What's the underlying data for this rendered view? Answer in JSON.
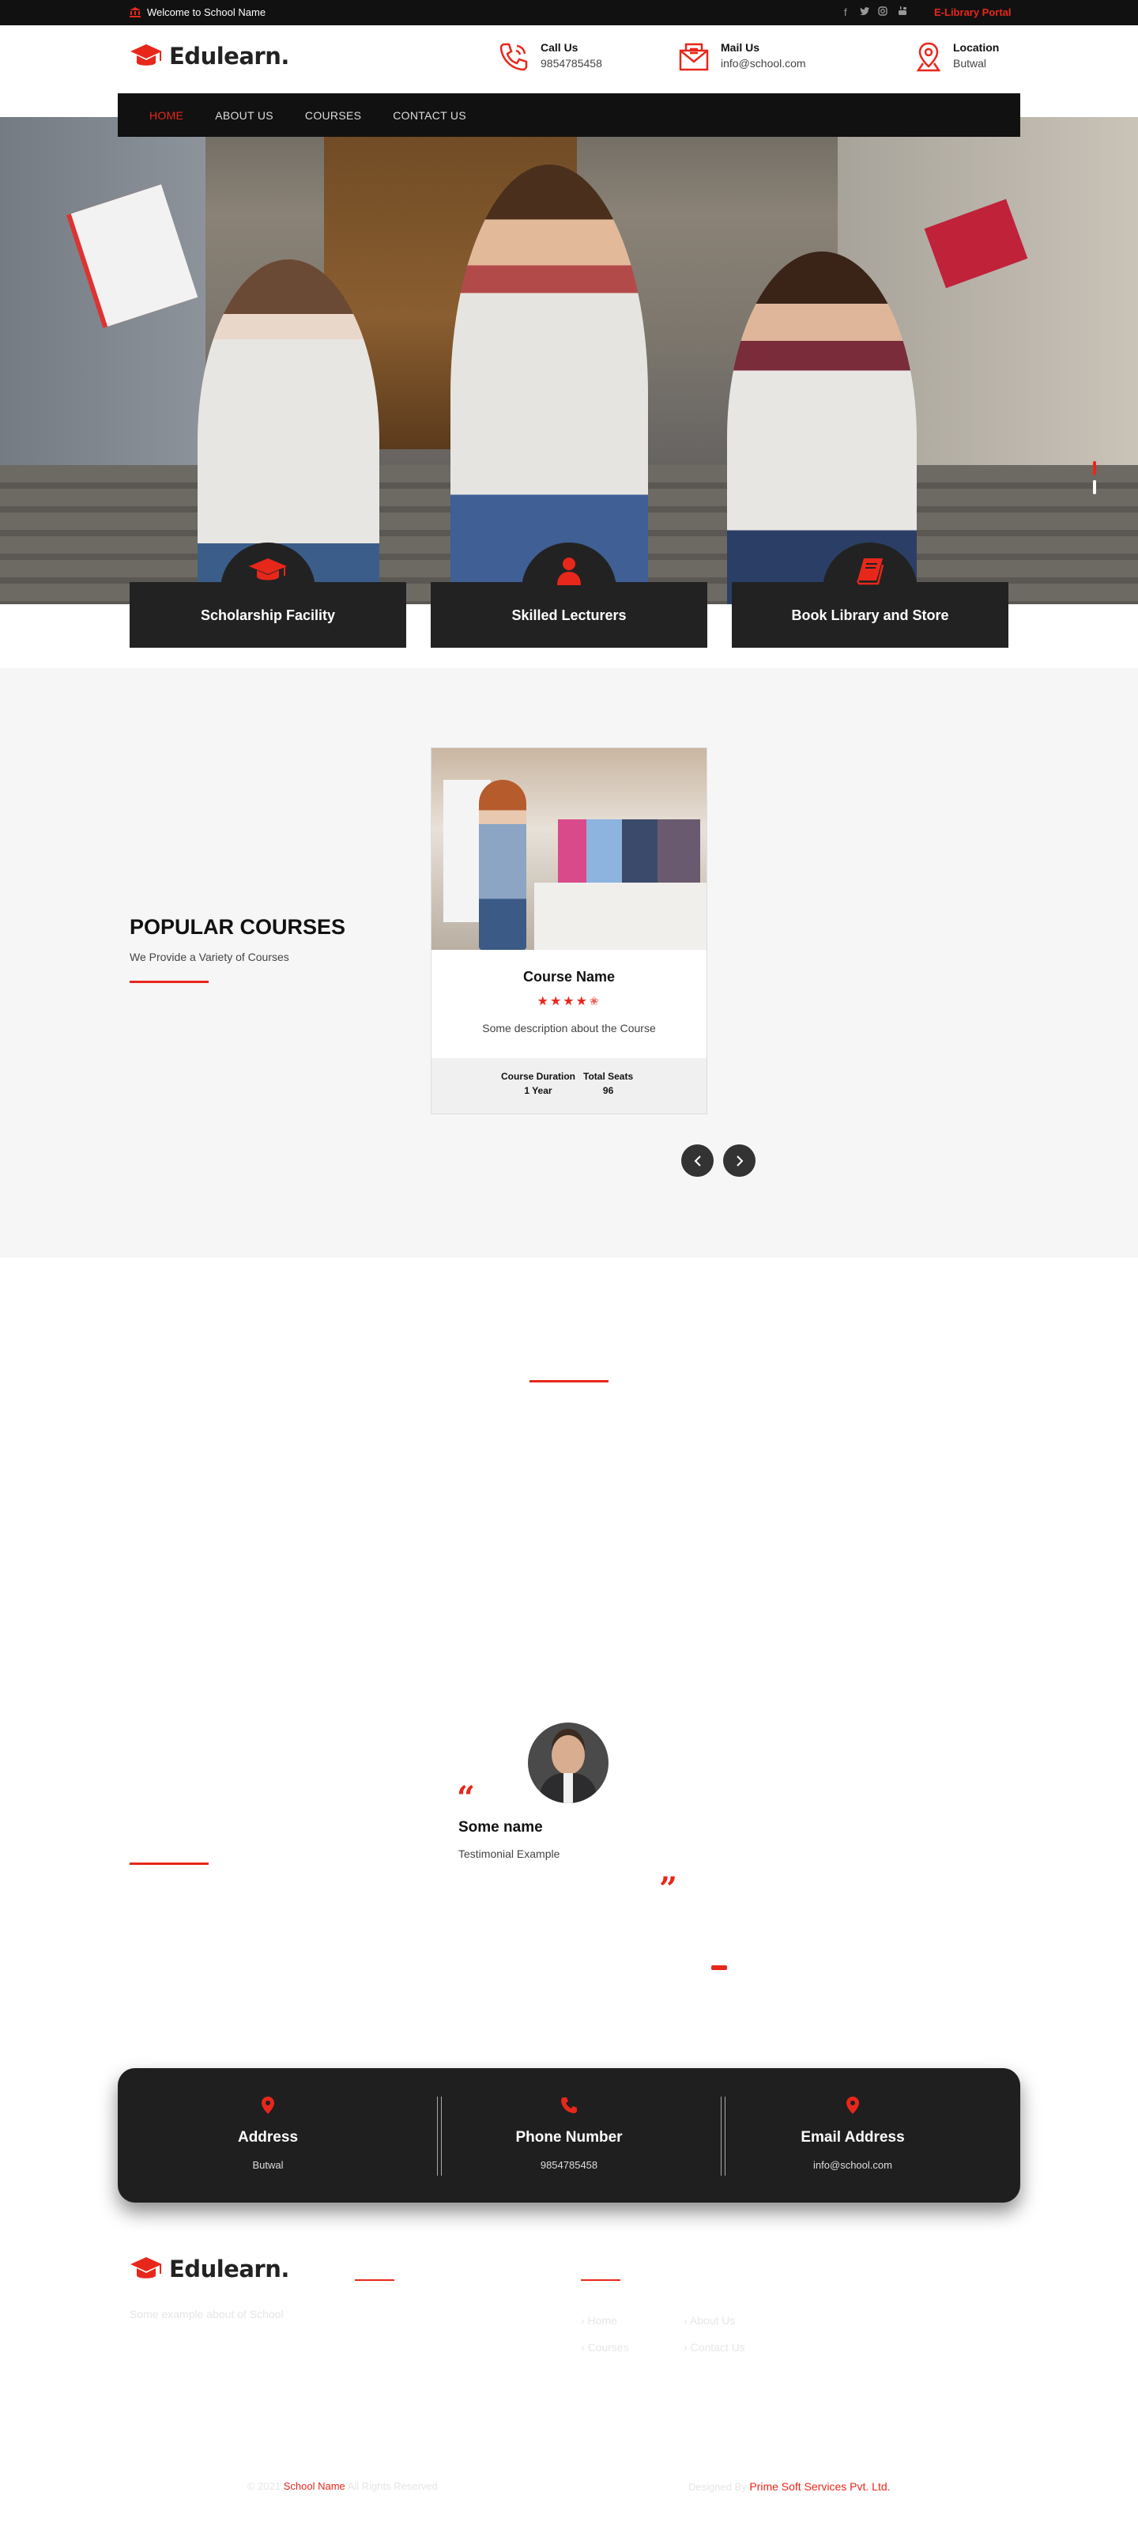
{
  "topbar": {
    "welcome": "Welcome to School Name",
    "social_icons": [
      "facebook-icon",
      "twitter-icon",
      "instagram-icon",
      "youtube-icon"
    ],
    "elibrary_link": "E-Library Portal"
  },
  "header": {
    "brand": "Edulearn.",
    "call": {
      "title": "Call Us",
      "value": "9854785458"
    },
    "mail": {
      "title": "Mail Us",
      "value": "info@school.com"
    },
    "location": {
      "title": "Location",
      "value": "Butwal"
    }
  },
  "nav": {
    "items": [
      {
        "label": "HOME",
        "active": true
      },
      {
        "label": "ABOUT US",
        "active": false
      },
      {
        "label": "COURSES",
        "active": false
      },
      {
        "label": "CONTACT US",
        "active": false
      }
    ]
  },
  "features": [
    {
      "label": "Scholarship Facility",
      "icon": "graduation-cap-icon"
    },
    {
      "label": "Skilled Lecturers",
      "icon": "user-icon"
    },
    {
      "label": "Book Library and Store",
      "icon": "book-icon"
    }
  ],
  "courses": {
    "heading": "POPULAR COURSES",
    "subheading": "We Provide a Variety of Courses",
    "card": {
      "name": "Course Name",
      "rating": 4.5,
      "description": "Some description about the Course",
      "duration_label": "Course Duration",
      "duration_value": "1 Year",
      "seats_label": "Total Seats",
      "seats_value": "96"
    }
  },
  "testimonial": {
    "name": "Some name",
    "text": "Testimonial Example"
  },
  "contact": {
    "address": {
      "title": "Address",
      "value": "Butwal"
    },
    "phone": {
      "title": "Phone Number",
      "value": "9854785458"
    },
    "email": {
      "title": "Email Address",
      "value": "info@school.com"
    }
  },
  "footer": {
    "brand": "Edulearn.",
    "about": "Some example about of School",
    "links": [
      "Home",
      "About Us",
      "Courses",
      "Contact Us"
    ],
    "copyright_prefix": "© 2021",
    "copyright_name": "School Name",
    "copyright_suffix": "All Rights Reserved",
    "designed_prefix": "Designed By",
    "designed_name": "Prime Soft Services Pvt. Ltd."
  },
  "colors": {
    "accent": "#e8271b",
    "dark": "#111111",
    "panel": "#222222"
  }
}
